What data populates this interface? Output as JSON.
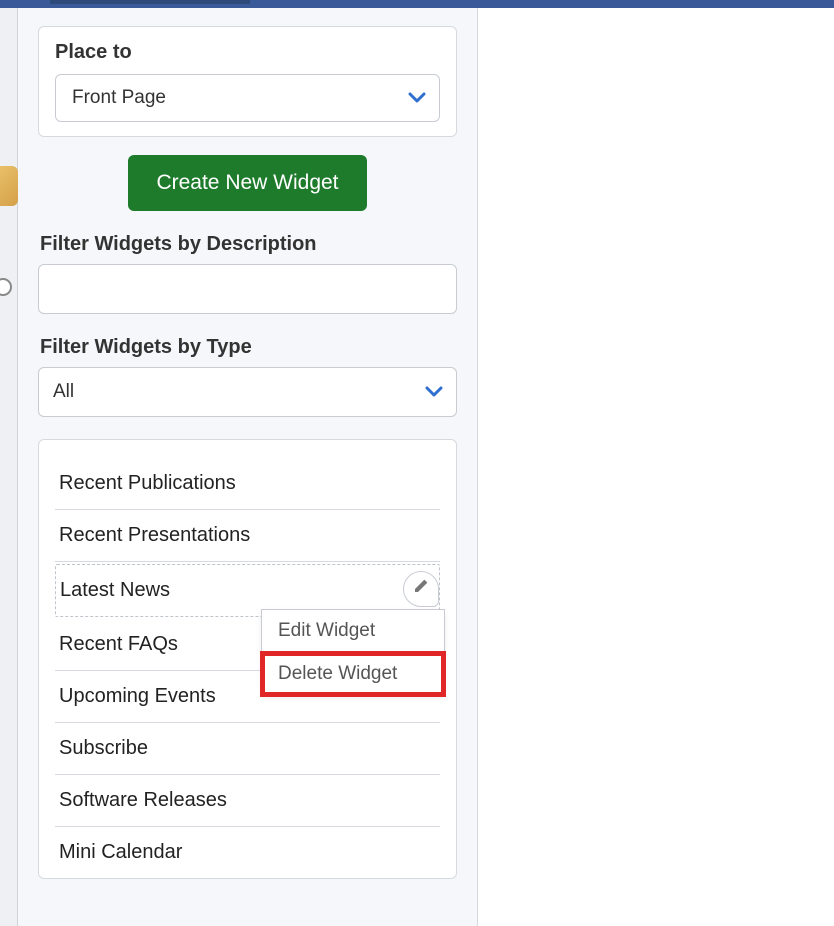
{
  "place_to": {
    "label": "Place to",
    "value": "Front Page"
  },
  "create_button_label": "Create New Widget",
  "filter_description": {
    "label": "Filter Widgets by Description",
    "value": ""
  },
  "filter_type": {
    "label": "Filter Widgets by Type",
    "value": "All"
  },
  "widgets": [
    "Recent Publications",
    "Recent Presentations",
    "Latest News",
    "Recent FAQs",
    "Upcoming Events",
    "Subscribe",
    "Software Releases",
    "Mini Calendar"
  ],
  "context_menu": {
    "edit_label": "Edit Widget",
    "delete_label": "Delete Widget"
  },
  "colors": {
    "accent_blue": "#2f6fd0",
    "button_green": "#1e7b2c",
    "highlight_red": "#e02626"
  }
}
